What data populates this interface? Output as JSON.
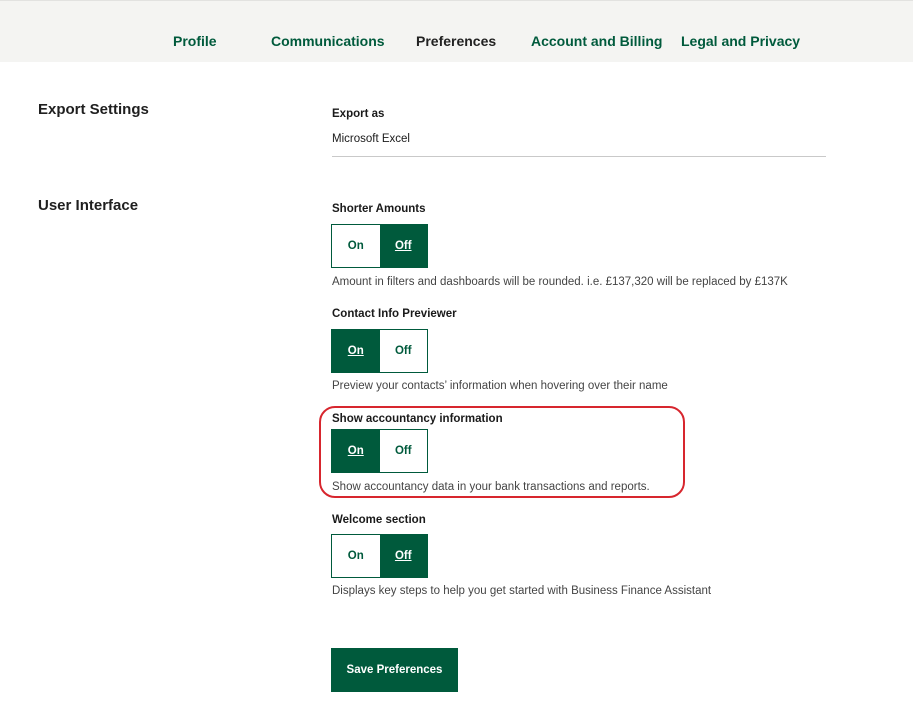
{
  "nav": {
    "items": [
      {
        "label": "Profile",
        "current": false
      },
      {
        "label": "Communications",
        "current": false
      },
      {
        "label": "Preferences",
        "current": true
      },
      {
        "label": "Account and Billing",
        "current": false
      },
      {
        "label": "Legal and Privacy",
        "current": false
      }
    ]
  },
  "export_settings": {
    "heading": "Export Settings",
    "field_label": "Export as",
    "field_value": "Microsoft Excel"
  },
  "user_interface": {
    "heading": "User Interface",
    "settings": [
      {
        "title": "Shorter Amounts",
        "on_label": "On",
        "off_label": "Off",
        "value": "Off",
        "description": "Amount in filters and dashboards will be rounded. i.e. £137,320 will be replaced by £137K"
      },
      {
        "title": "Contact Info Previewer",
        "on_label": "On",
        "off_label": "Off",
        "value": "On",
        "description": "Preview your contacts’ information when hovering over their name"
      },
      {
        "title": "Show accountancy information",
        "on_label": "On",
        "off_label": "Off",
        "value": "On",
        "description": "Show accountancy data in your bank transactions and reports."
      },
      {
        "title": "Welcome section",
        "on_label": "On",
        "off_label": "Off",
        "value": "Off",
        "description": "Displays key steps to help you get started with Business Finance Assistant"
      }
    ]
  },
  "save_label": "Save Preferences",
  "colors": {
    "brand_green": "#005a3c",
    "nav_background": "#f4f4f2",
    "highlight_red": "#d7262e"
  }
}
